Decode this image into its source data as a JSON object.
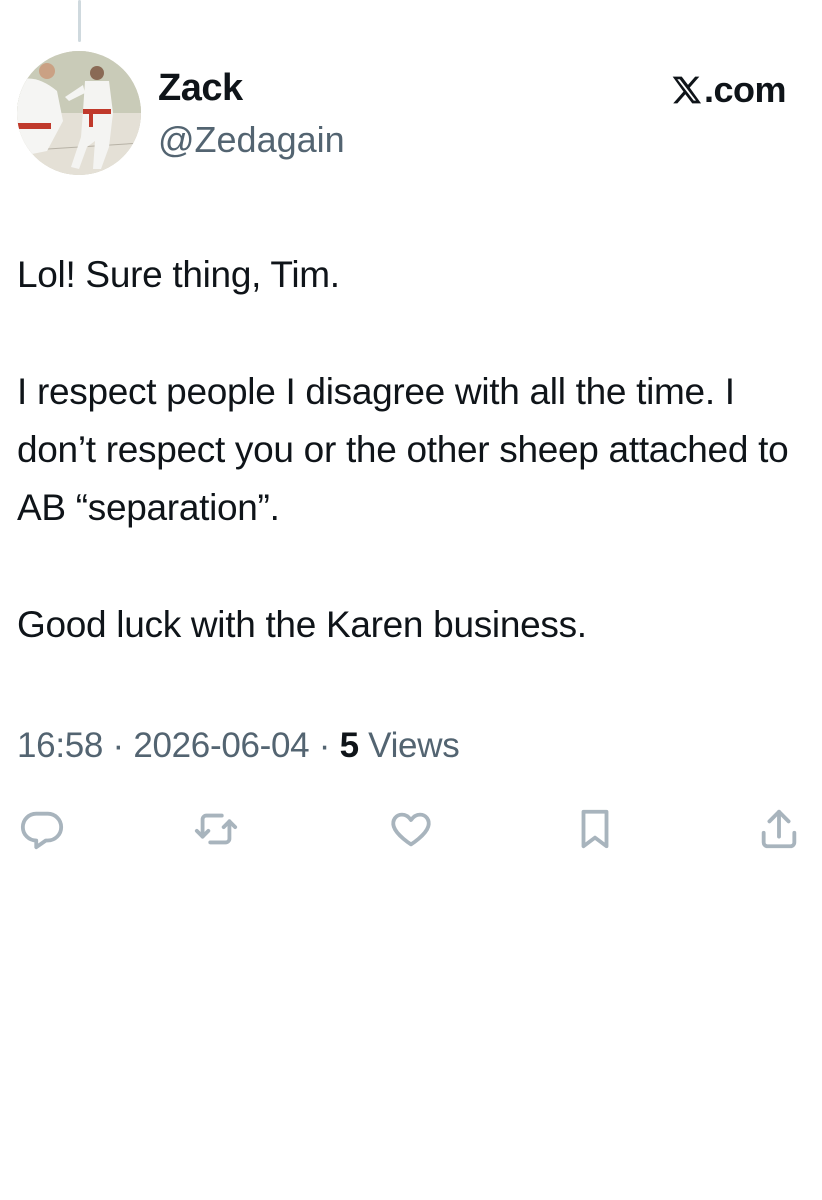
{
  "author": {
    "display_name": "Zack",
    "handle": "@Zedagain",
    "avatar": "karate-practitioner-photo"
  },
  "brand": {
    "label": ".com",
    "icon": "x-logo-icon"
  },
  "tweet": {
    "paragraphs": [
      "Lol! Sure thing, Tim.",
      "I respect people I disagree with all the time. I don’t respect you or the other sheep attached to AB “separation”.",
      "Good luck with the Karen business."
    ]
  },
  "meta": {
    "time": "16:58",
    "separator": " · ",
    "date": "2026-06-04",
    "views_count": "5",
    "views_label": " Views"
  },
  "actions": [
    {
      "name": "reply",
      "icon": "reply-icon"
    },
    {
      "name": "repost",
      "icon": "repost-icon"
    },
    {
      "name": "like",
      "icon": "heart-icon"
    },
    {
      "name": "bookmark",
      "icon": "bookmark-icon"
    },
    {
      "name": "share",
      "icon": "share-icon"
    }
  ],
  "colors": {
    "text_primary": "#0f1419",
    "text_secondary": "#536471",
    "icon_gray": "#a8b4bd",
    "thread_line": "#cfd9de"
  }
}
